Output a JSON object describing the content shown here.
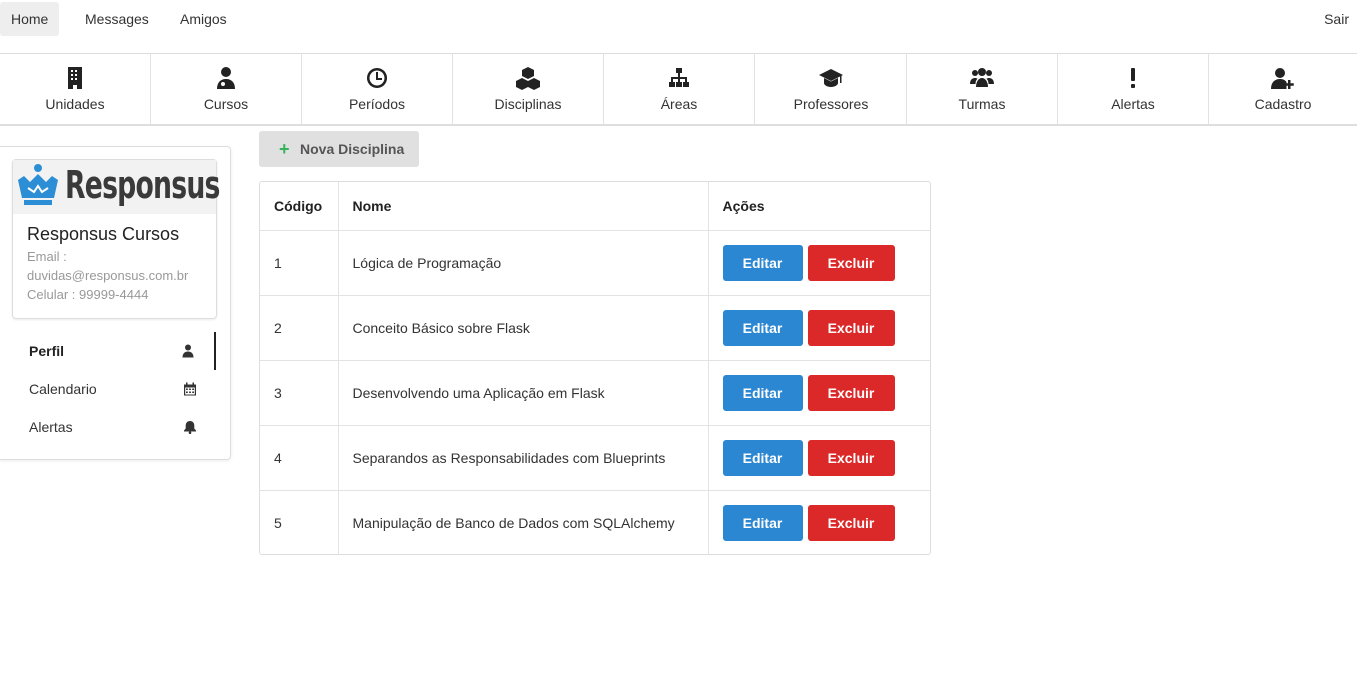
{
  "topnav": {
    "tabs": [
      {
        "label": "Home",
        "active": true
      },
      {
        "label": "Messages",
        "active": false
      },
      {
        "label": "Amigos",
        "active": false
      }
    ],
    "logout": "Sair"
  },
  "iconmenu": [
    {
      "label": "Unidades",
      "icon": "building-icon"
    },
    {
      "label": "Cursos",
      "icon": "user-doctor-icon"
    },
    {
      "label": "Períodos",
      "icon": "clock-icon"
    },
    {
      "label": "Disciplinas",
      "icon": "cubes-icon"
    },
    {
      "label": "Áreas",
      "icon": "sitemap-icon"
    },
    {
      "label": "Professores",
      "icon": "graduation-cap-icon"
    },
    {
      "label": "Turmas",
      "icon": "users-icon"
    },
    {
      "label": "Alertas",
      "icon": "exclamation-icon"
    },
    {
      "label": "Cadastro",
      "icon": "user-plus-icon"
    }
  ],
  "profile": {
    "logo_text": "Responsus",
    "name": "Responsus Cursos",
    "email_label": "Email :",
    "email": "duvidas@responsus.com.br",
    "phone": "Celular : 99999-4444"
  },
  "sidemenu": [
    {
      "label": "Perfil",
      "icon": "user-icon",
      "active": true
    },
    {
      "label": "Calendario",
      "icon": "calendar-icon",
      "active": false
    },
    {
      "label": "Alertas",
      "icon": "bell-icon",
      "active": false
    }
  ],
  "main": {
    "new_button": "Nova Disciplina",
    "table": {
      "headers": [
        "Código",
        "Nome",
        "Ações"
      ],
      "rows": [
        {
          "code": "1",
          "name": "Lógica de Programação"
        },
        {
          "code": "2",
          "name": "Conceito Básico sobre Flask"
        },
        {
          "code": "3",
          "name": "Desenvolvendo uma Aplicação em Flask"
        },
        {
          "code": "4",
          "name": "Separandos as Responsabilidades com Blueprints"
        },
        {
          "code": "5",
          "name": "Manipulação de Banco de Dados com SQLAlchemy"
        }
      ],
      "edit_label": "Editar",
      "delete_label": "Excluir"
    }
  },
  "colors": {
    "edit": "#2b87d1",
    "delete": "#db2828",
    "add": "#35b45a",
    "logo_blue": "#2c8fd6"
  }
}
